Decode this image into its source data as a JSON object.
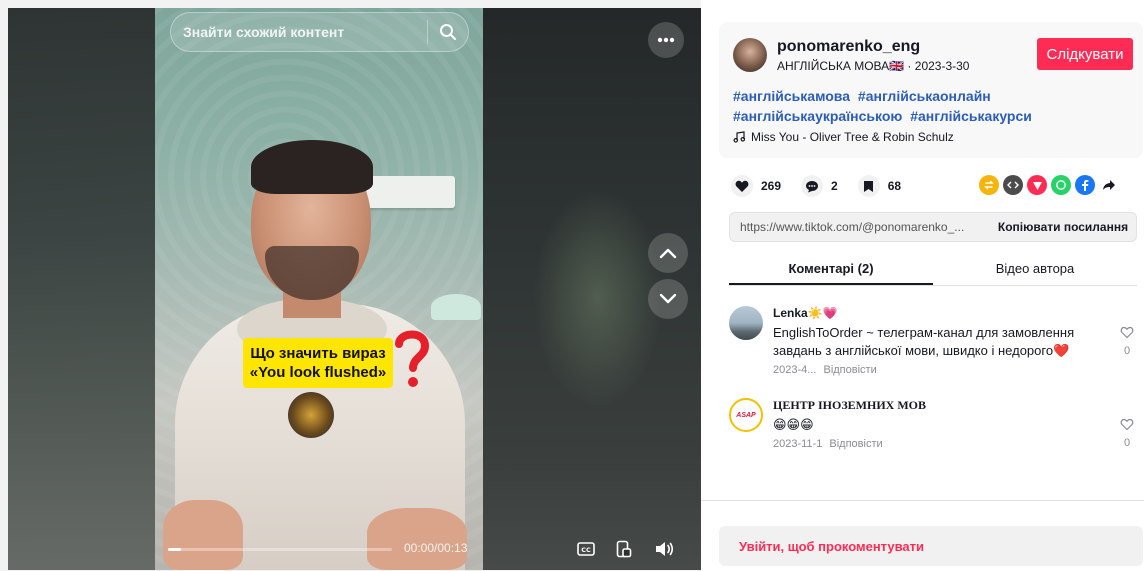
{
  "search": {
    "placeholder": "Знайти схожий контент"
  },
  "video": {
    "question_line1": "Що значить вираз",
    "question_line2": "«You look flushed»",
    "time": "00:00/00:13",
    "progress": 0.06
  },
  "author": {
    "username": "ponomarenko_eng",
    "nickname": "АНГЛІЙСЬКА МОВА🇬🇧",
    "date": "2023-3-30",
    "follow_label": "Слідкувати"
  },
  "description": {
    "hashtags": [
      "#англійськамова",
      "#англійськаонлайн",
      "#англійськаукраїнською",
      "#англійськакурси"
    ],
    "music": "Miss You - Oliver Tree & Robin Schulz"
  },
  "stats": {
    "likes": "269",
    "comments": "2",
    "saves": "68"
  },
  "share": {
    "icons": [
      "repost-icon",
      "embed-icon",
      "send-icon",
      "whatsapp-icon",
      "facebook-icon",
      "share-arrow-icon"
    ],
    "link": "https://www.tiktok.com/@ponomarenko_...",
    "copy_label": "Копіювати посилання"
  },
  "tabs": {
    "comments": "Коментарі (2)",
    "author_videos": "Відео автора"
  },
  "comments": [
    {
      "name": "Lenka☀️💗",
      "text": "EnglishToOrder ~ телеграм-канал для замовлення завдань з англійської мови, швидко і недорого❤️",
      "date": "2023-4...",
      "reply": "Відповісти",
      "likes": "0"
    },
    {
      "name": "ЦЕНТР ІНОЗЕМНИХ МОВ",
      "text": "😁😁😁",
      "date": "2023-11-1",
      "reply": "Відповісти",
      "likes": "0",
      "avatar_text": "ASAP"
    }
  ],
  "login": {
    "label": "Увійти, щоб прокоментувати"
  },
  "colors": {
    "accent": "#fe2c55",
    "hashtag": "#2b5db9",
    "question_card": "#ffe600"
  }
}
